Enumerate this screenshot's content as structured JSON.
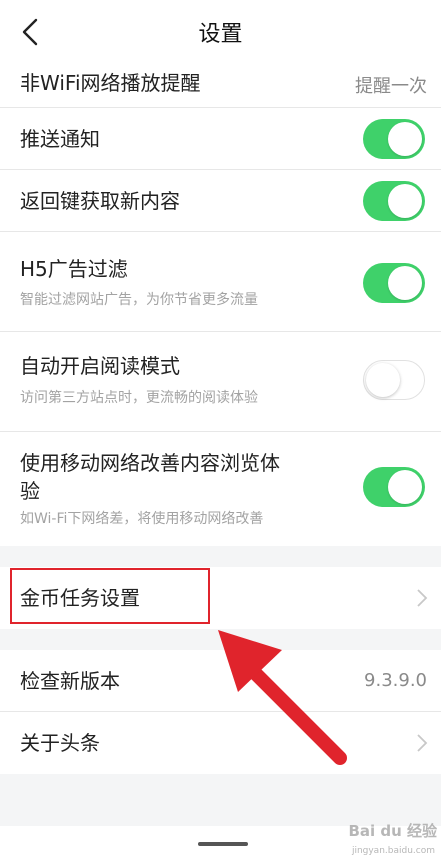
{
  "header": {
    "title": "设置"
  },
  "rows": {
    "nonwifi": {
      "label": "非WiFi网络播放提醒",
      "value": "提醒一次"
    },
    "push": {
      "label": "推送通知",
      "toggle": "on"
    },
    "backkey": {
      "label": "返回键获取新内容",
      "toggle": "on"
    },
    "h5": {
      "label": "H5广告过滤",
      "sub": "智能过滤网站广告，为你节省更多流量",
      "toggle": "on"
    },
    "reading": {
      "label": "自动开启阅读模式",
      "sub": "访问第三方站点时，更流畅的阅读体验",
      "toggle": "off"
    },
    "mobile": {
      "label_line1": "使用移动网络改善内容浏览体",
      "label_line2": "验",
      "sub": "如Wi-Fi下网络差，将使用移动网络改善",
      "toggle": "on"
    },
    "coins": {
      "label": "金币任务设置"
    },
    "update": {
      "label": "检查新版本",
      "value": "9.3.9.0"
    },
    "about": {
      "label": "关于头条"
    }
  },
  "annotation": {
    "highlight_color": "#e0242c",
    "arrow_color": "#e0242c"
  },
  "colors": {
    "toggle_on": "#3fd16a",
    "background": "#f4f5f6"
  },
  "watermark": {
    "brand": "Bai du 经验",
    "url": "jingyan.baidu.com"
  }
}
